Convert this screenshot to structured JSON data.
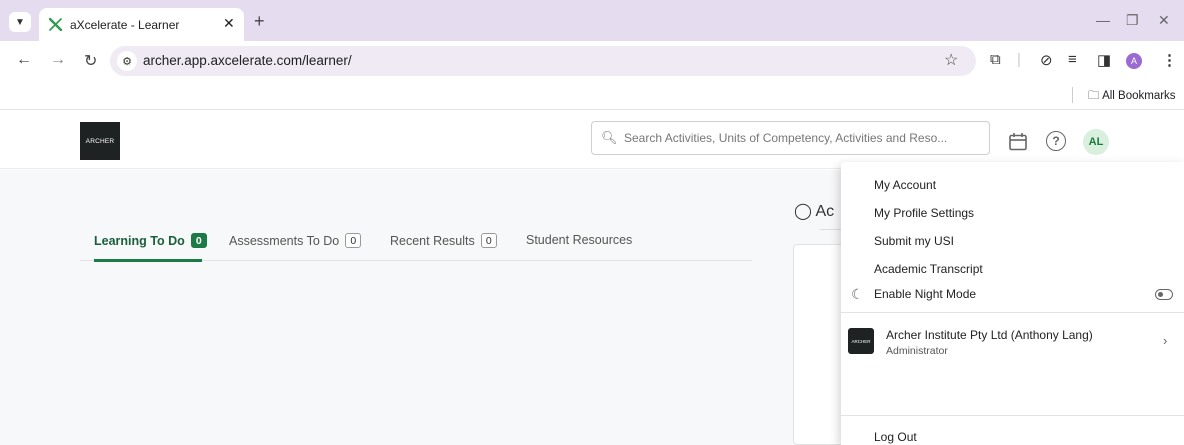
{
  "browser": {
    "tab_title": "aXcelerate - Learner",
    "new_tab_symbol": "+",
    "url": "archer.app.axcelerate.com/learner/",
    "profile_initial": "A",
    "bookmarks_label": "All Bookmarks"
  },
  "header": {
    "logo_text": "ARCHER",
    "search_placeholder": "Search Activities, Units of Competency, Activities and Reso...",
    "avatar_initials": "AL"
  },
  "tabs": [
    {
      "label": "Learning To Do",
      "count": "0"
    },
    {
      "label": "Assessments To Do",
      "count": "0"
    },
    {
      "label": "Recent Results",
      "count": "0"
    },
    {
      "label": "Student Resources"
    }
  ],
  "activity": {
    "heading": "Ac"
  },
  "user_menu": {
    "items": [
      "My Account",
      "My Profile Settings",
      "Submit my USI",
      "Academic Transcript"
    ],
    "night_mode_label": "Enable Night Mode",
    "org_logo_text": "ARCHER",
    "org_name": "Archer Institute Pty Ltd (Anthony Lang)",
    "org_role": "Administrator",
    "logout_label": "Log Out"
  }
}
